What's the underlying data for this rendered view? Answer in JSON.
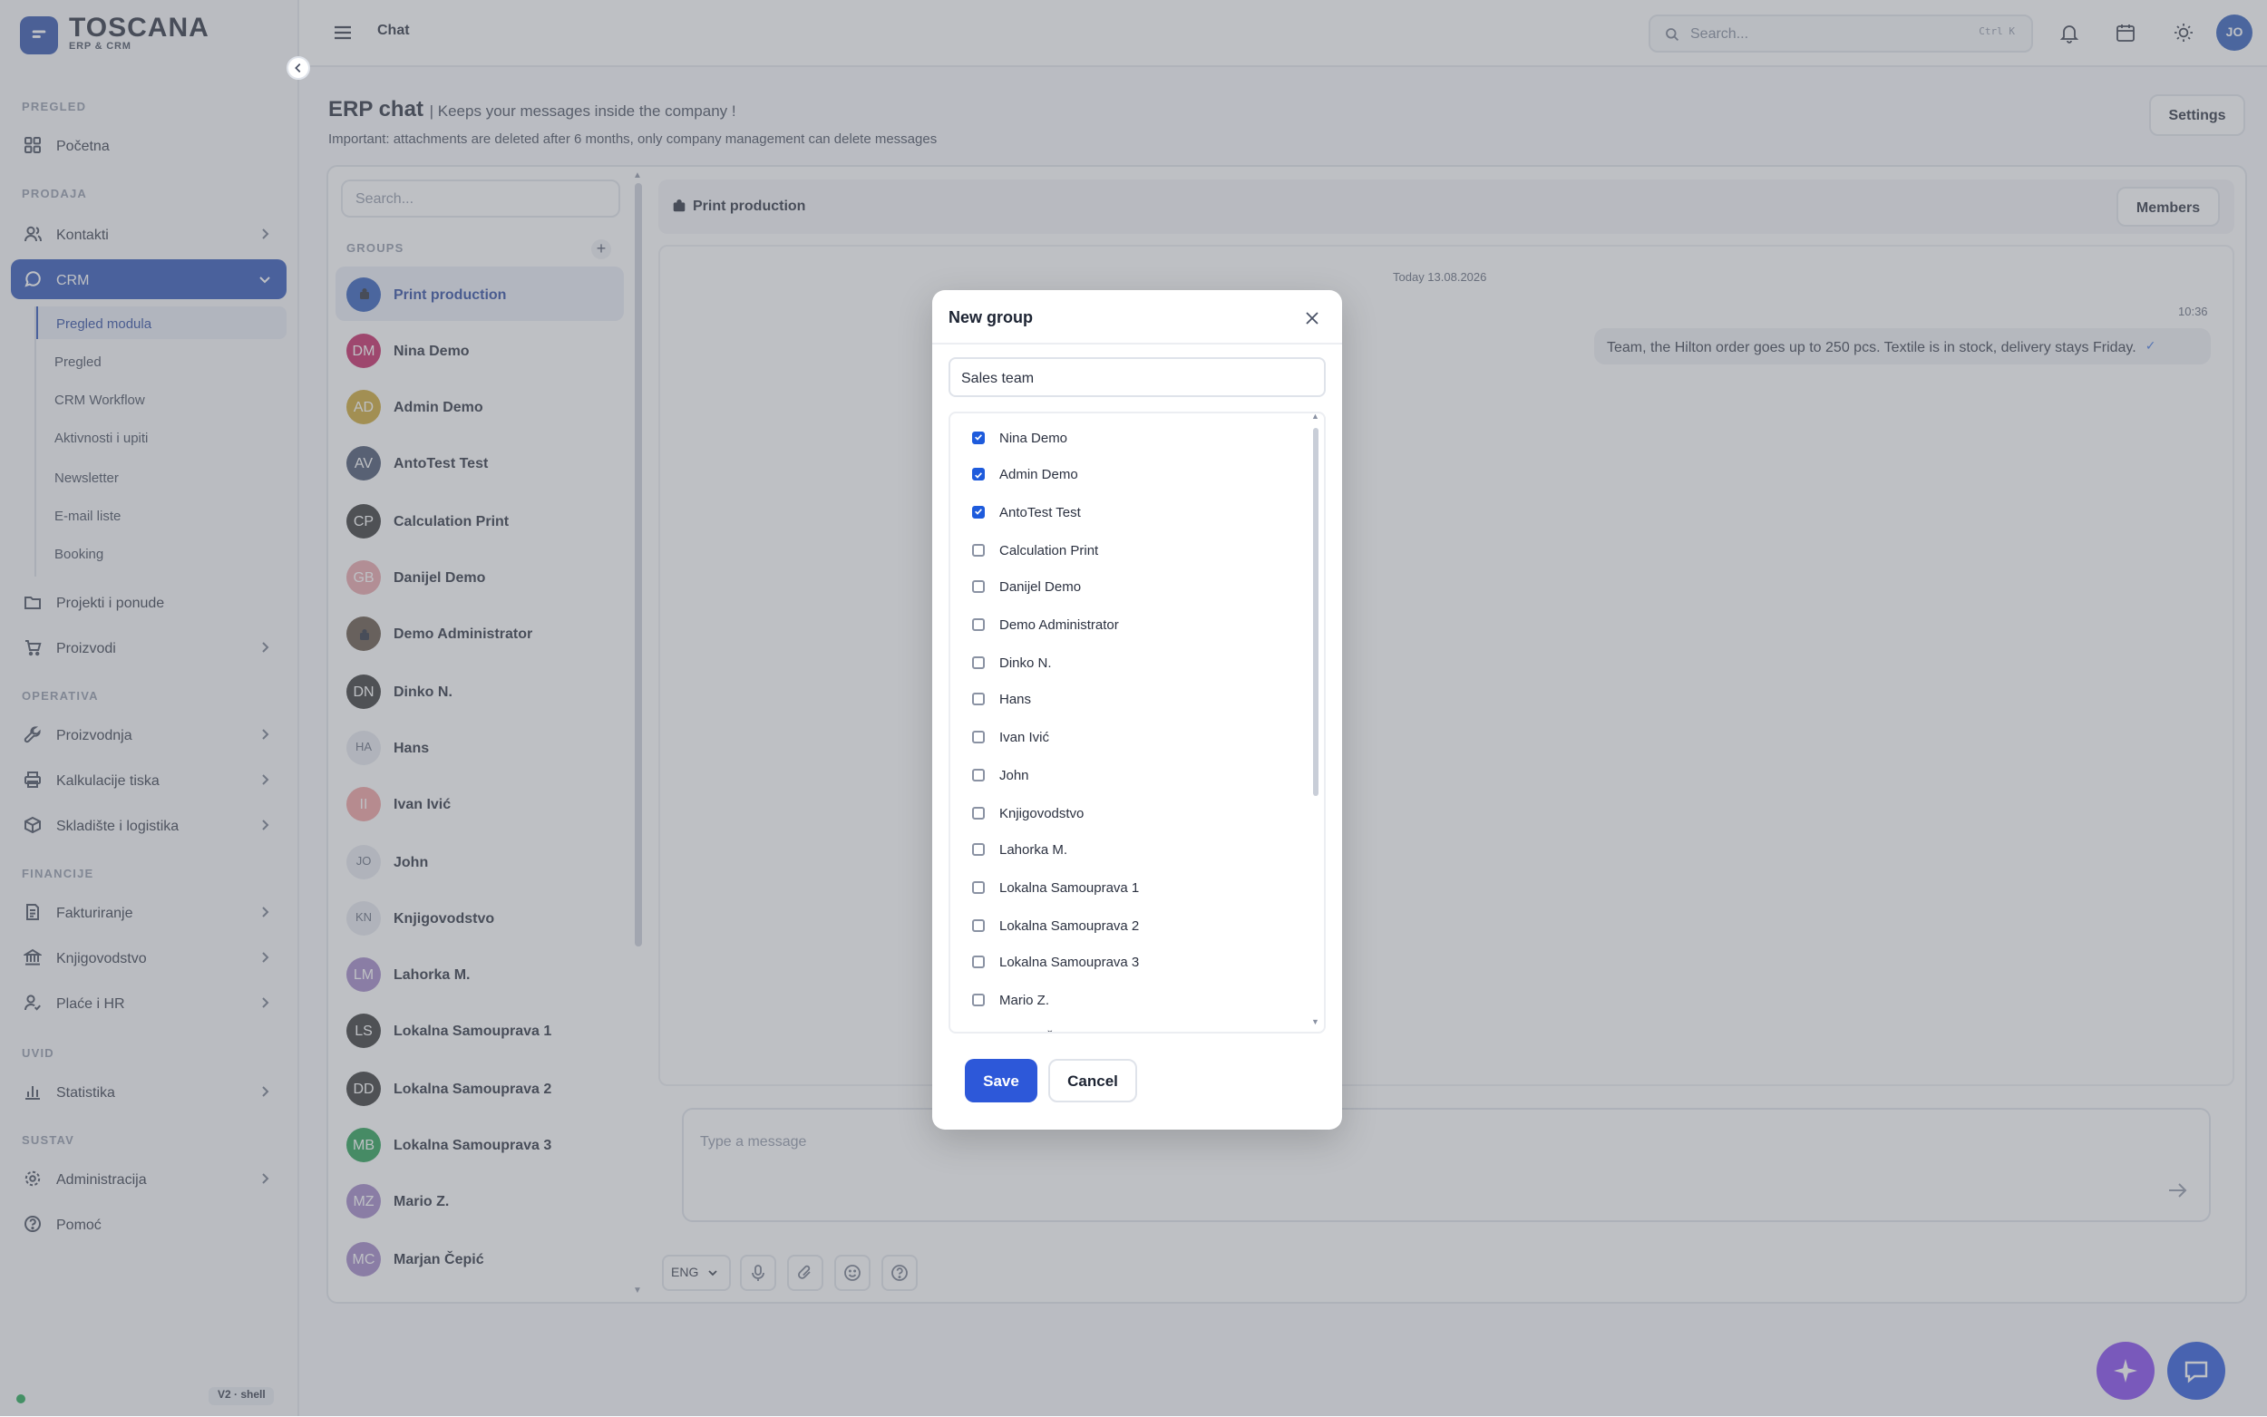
{
  "brand": {
    "name": "TOSCANA",
    "sub": "ERP & CRM"
  },
  "topbar": {
    "title": "Chat",
    "search_placeholder": "Search...",
    "search_shortcut": "Ctrl K",
    "avatar_initials": "JO"
  },
  "sidebar": {
    "sections": {
      "pregled": "PREGLED",
      "prodaja": "PRODAJA",
      "operativa": "OPERATIVA",
      "financije": "FINANCIJE",
      "uvid": "UVID",
      "sustav": "SUSTAV"
    },
    "items": {
      "pocetna": "Početna",
      "kontakti": "Kontakti",
      "crm": "CRM",
      "projekti": "Projekti i ponude",
      "proizvodi": "Proizvodi",
      "proizvodnja": "Proizvodnja",
      "kalkulacije": "Kalkulacije tiska",
      "skladiste": "Skladište i logistika",
      "fakturiranje": "Fakturiranje",
      "knjigovodstvo": "Knjigovodstvo",
      "place": "Plaće i HR",
      "statistika": "Statistika",
      "administracija": "Administracija",
      "pomoc": "Pomoć"
    },
    "crm_sub": [
      "Pregled modula",
      "Pregled",
      "CRM Workflow",
      "Aktivnosti i upiti",
      "Newsletter",
      "E-mail liste",
      "Booking"
    ],
    "version": "V2 · shell"
  },
  "header": {
    "title": "ERP chat",
    "tagline": "| Keeps your messages inside the company !",
    "note": "Important: attachments are deleted after 6 months, only company management can delete messages",
    "settings": "Settings"
  },
  "chat_list": {
    "search_placeholder": "Search...",
    "groups_label": "GROUPS",
    "add_label": "+",
    "contacts": [
      {
        "name": "Print production",
        "initials": "",
        "color": "#2454b6"
      },
      {
        "name": "Nina Demo",
        "initials": "DM",
        "color": "#c2185b"
      },
      {
        "name": "Admin Demo",
        "initials": "AD",
        "color": "#c9a227"
      },
      {
        "name": "AntoTest Test",
        "initials": "AV",
        "color": "#3c4a66"
      },
      {
        "name": "Calculation Print",
        "initials": "CP",
        "color": "#2b2b2b"
      },
      {
        "name": "Danijel Demo",
        "initials": "GB",
        "color": "#e8a0a6"
      },
      {
        "name": "Demo Administrator",
        "initials": "",
        "color": "#5a4a3a"
      },
      {
        "name": "Dinko N.",
        "initials": "DN",
        "color": "#2b2b2b"
      },
      {
        "name": "Hans",
        "initials": "HA",
        "color": "#e4e7ee"
      },
      {
        "name": "Ivan Ivić",
        "initials": "II",
        "color": "#ef9a9a"
      },
      {
        "name": "John",
        "initials": "JO",
        "color": "#e4e7ee"
      },
      {
        "name": "Knjigovodstvo",
        "initials": "KN",
        "color": "#e4e7ee"
      },
      {
        "name": "Lahorka M.",
        "initials": "LM",
        "color": "#9b7fc4"
      },
      {
        "name": "Lokalna Samouprava 1",
        "initials": "LS",
        "color": "#2b2b2b"
      },
      {
        "name": "Lokalna Samouprava 2",
        "initials": "DD",
        "color": "#2b2b2b"
      },
      {
        "name": "Lokalna Samouprava 3",
        "initials": "MB",
        "color": "#1a9a4a"
      },
      {
        "name": "Mario Z.",
        "initials": "MZ",
        "color": "#9b7fc4"
      },
      {
        "name": "Marjan Čepić",
        "initials": "MC",
        "color": "#9b7fc4"
      }
    ]
  },
  "conversation": {
    "title": "Print production",
    "members_button": "Members",
    "date_divider": "Today 13.08.2026",
    "messages": [
      {
        "time": "10:36",
        "text": "Team, the Hilton order goes up to 250 pcs. Textile is in stock, delivery stays Friday.",
        "status": "✓"
      }
    ],
    "composer_placeholder": "Type a message",
    "language": "ENG"
  },
  "modal": {
    "title": "New group",
    "name_value": "Sales team",
    "members": [
      {
        "name": "Nina Demo",
        "checked": true
      },
      {
        "name": "Admin Demo",
        "checked": true
      },
      {
        "name": "AntoTest Test",
        "checked": true
      },
      {
        "name": "Calculation Print",
        "checked": false
      },
      {
        "name": "Danijel Demo",
        "checked": false
      },
      {
        "name": "Demo Administrator",
        "checked": false
      },
      {
        "name": "Dinko N.",
        "checked": false
      },
      {
        "name": "Hans",
        "checked": false
      },
      {
        "name": "Ivan Ivić",
        "checked": false
      },
      {
        "name": "John",
        "checked": false
      },
      {
        "name": "Knjigovodstvo",
        "checked": false
      },
      {
        "name": "Lahorka M.",
        "checked": false
      },
      {
        "name": "Lokalna Samouprava 1",
        "checked": false
      },
      {
        "name": "Lokalna Samouprava 2",
        "checked": false
      },
      {
        "name": "Lokalna Samouprava 3",
        "checked": false
      },
      {
        "name": "Mario Z.",
        "checked": false
      },
      {
        "name": "Marjan Čepić",
        "checked": false
      }
    ],
    "save": "Save",
    "cancel": "Cancel"
  },
  "colors": {
    "accent": "#2249b3",
    "primary_button": "#2d58d9",
    "ai_fab": "#7c3aed",
    "chat_fab": "#1d4ed8"
  }
}
